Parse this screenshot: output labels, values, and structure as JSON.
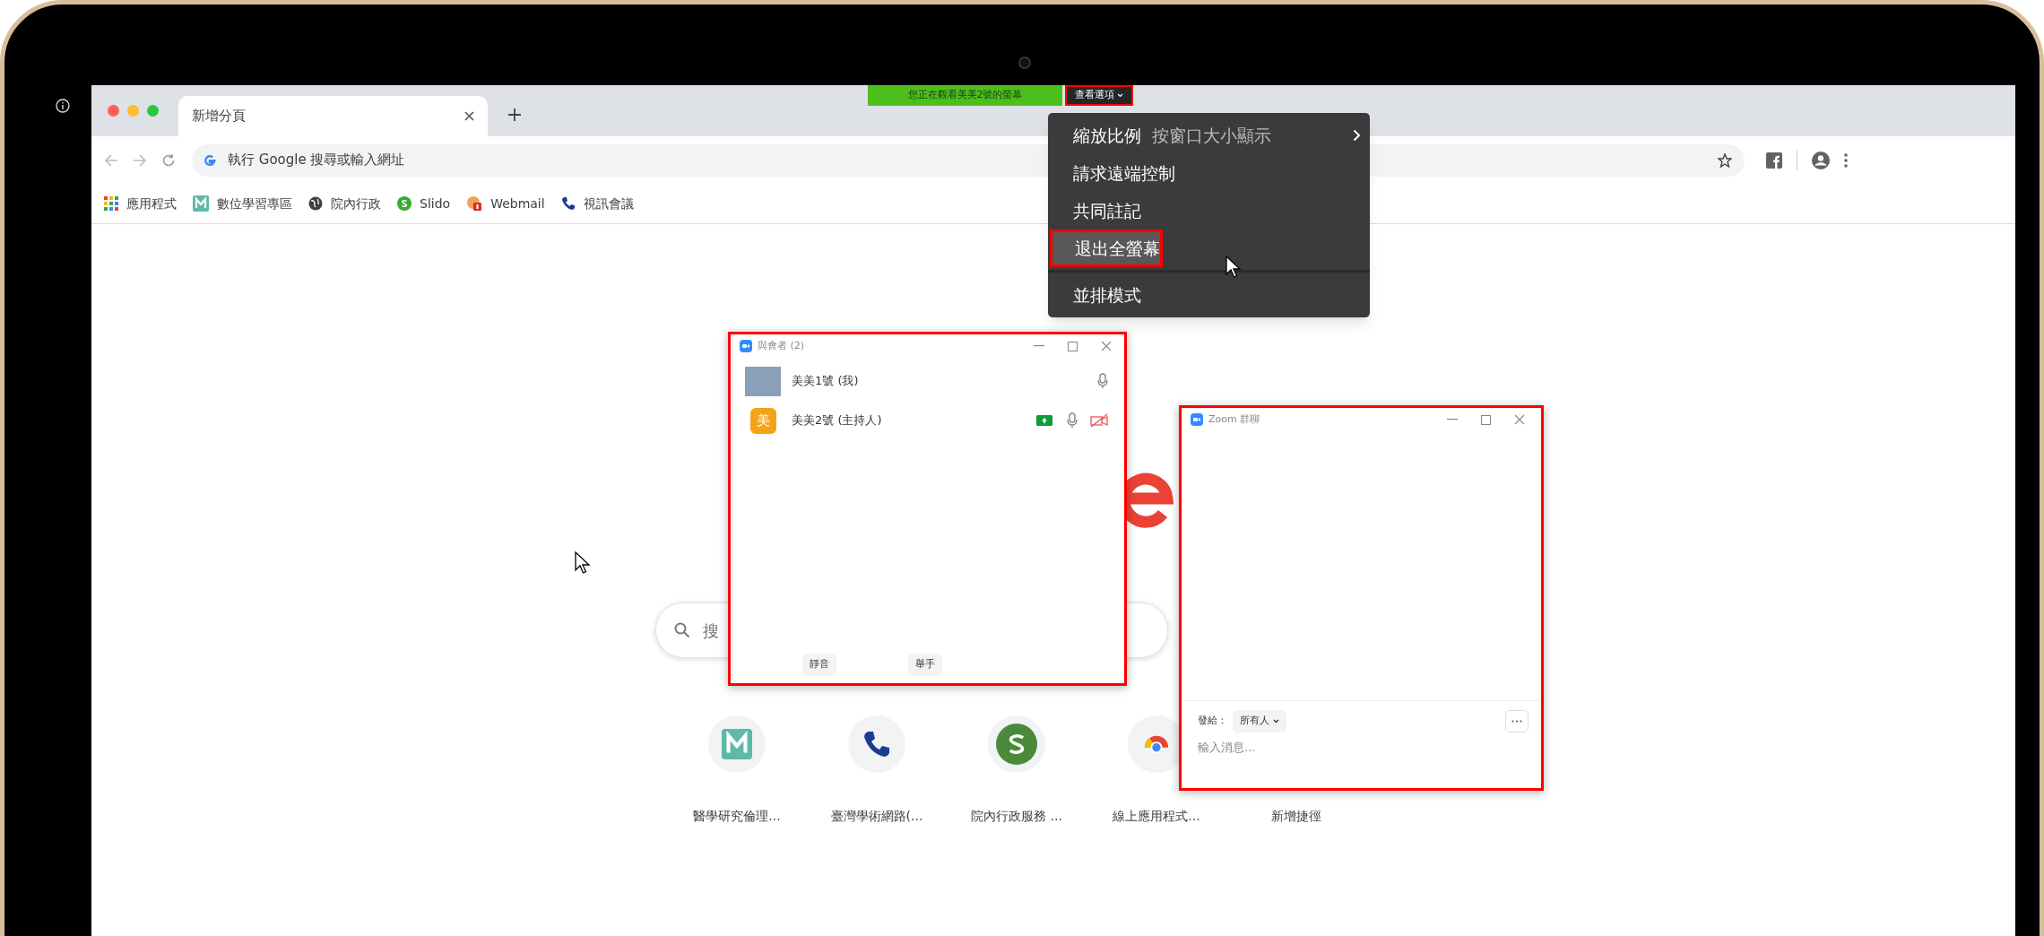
{
  "notice": {
    "text": "您正在觀看美美2號的螢幕"
  },
  "view_options_button": {
    "label": "查看選項",
    "highlighted": true
  },
  "view_menu": {
    "groups": [
      [
        {
          "label": "縮放比例",
          "value": "按窗口大小顯示",
          "kind": "submenu",
          "selected": false,
          "highlighted": false
        },
        {
          "label": "請求遠端控制",
          "kind": "item",
          "selected": false,
          "highlighted": false
        },
        {
          "label": "共同註記",
          "kind": "item",
          "selected": false,
          "highlighted": false
        },
        {
          "label": "退出全螢幕",
          "kind": "item",
          "selected": true,
          "highlighted": true
        }
      ],
      [
        {
          "label": "並排模式",
          "kind": "item",
          "selected": false,
          "highlighted": false
        }
      ]
    ]
  },
  "browser": {
    "tab": {
      "title": "新增分頁"
    },
    "omnibox": {
      "placeholder": "執行 Google 搜尋或輸入網址"
    },
    "bookmarks": [
      {
        "label": "應用程式",
        "kind": "apps"
      },
      {
        "label": "數位學習專區",
        "kind": "m"
      },
      {
        "label": "院內行政",
        "kind": "globe"
      },
      {
        "label": "Slido",
        "kind": "s"
      },
      {
        "label": "Webmail",
        "kind": "mail"
      },
      {
        "label": "視訊會議",
        "kind": "phone"
      }
    ],
    "search": {
      "placeholder": "搜"
    },
    "shortcuts": [
      {
        "label": "醫學研究倫理...",
        "kind": "m"
      },
      {
        "label": "臺灣學術網路(...",
        "kind": "phone"
      },
      {
        "label": "院內行政服務 ...",
        "kind": "s"
      },
      {
        "label": "線上應用程式...",
        "kind": "chrome"
      },
      {
        "label": "新增捷徑"
      }
    ]
  },
  "participants_window": {
    "title": "與會者 (2)",
    "highlighted": true,
    "participants": [
      {
        "name": "美美1號 (我)",
        "kind": "photo",
        "sharing": false,
        "video_off": false
      },
      {
        "name": "美美2號 (主持人)",
        "kind": "initial",
        "initial": "美",
        "sharing": true,
        "video_off": true
      }
    ],
    "buttons": [
      "靜音",
      "舉手"
    ]
  },
  "chat_window": {
    "title": "Zoom 群聊",
    "highlighted": true,
    "to_label": "發給：",
    "recipient": "所有人",
    "input": {
      "placeholder": "輸入消息..."
    }
  }
}
